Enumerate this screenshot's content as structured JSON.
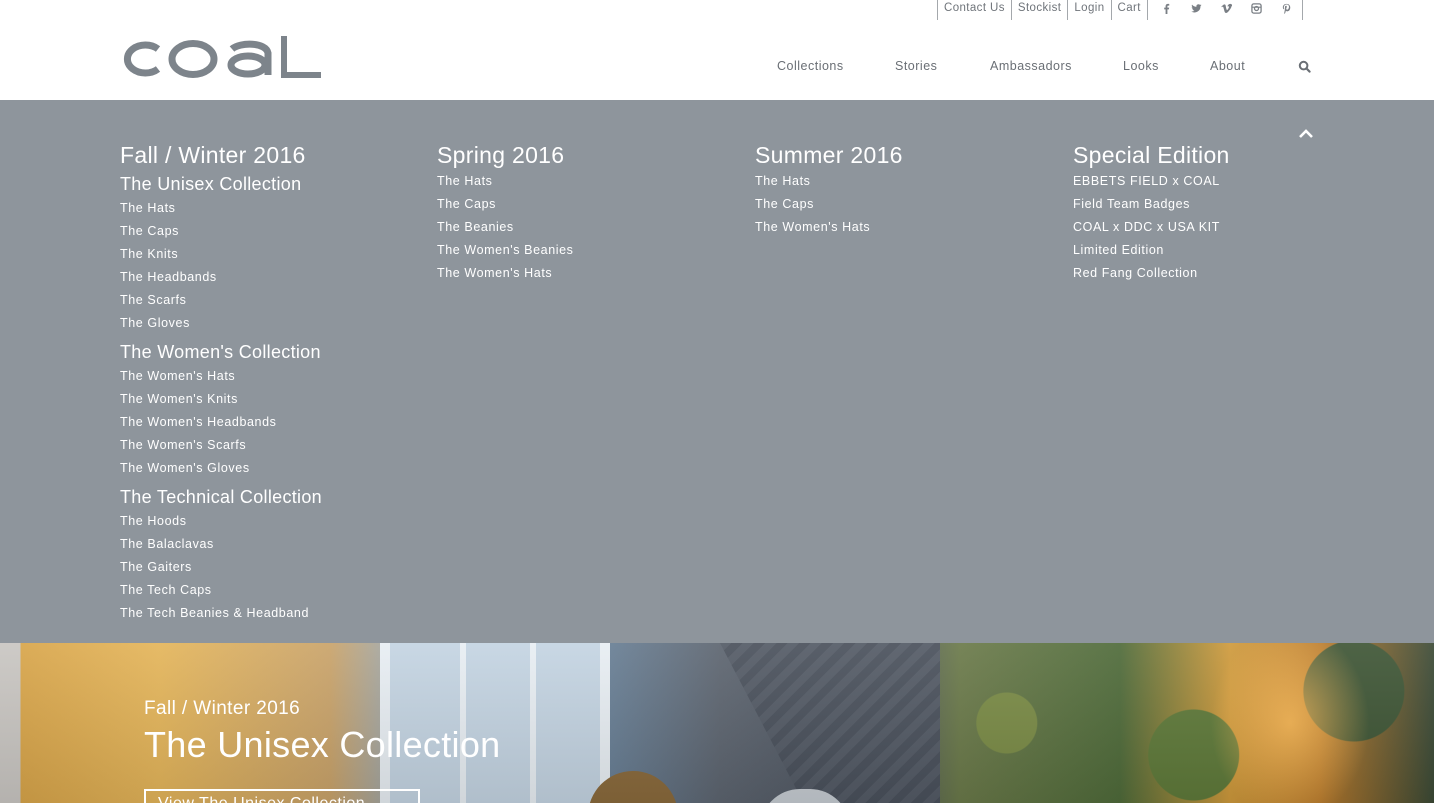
{
  "header": {
    "brand": "coal",
    "utility_links": [
      "Contact Us",
      "Stockist",
      "Login",
      "Cart"
    ],
    "social_icons": [
      "facebook-icon",
      "twitter-icon",
      "vimeo-icon",
      "instagram-icon",
      "pinterest-icon"
    ],
    "nav": [
      "Collections",
      "Stories",
      "Ambassadors",
      "Looks",
      "About"
    ],
    "search_icon": "search-icon"
  },
  "mega_menu": {
    "background_color": "#8e959c",
    "columns": [
      {
        "season": "Fall / Winter 2016",
        "groups": [
          {
            "title": "The Unisex Collection",
            "items": [
              "The Hats",
              "The Caps",
              "The Knits",
              "The Headbands",
              "The Scarfs",
              "The Gloves"
            ]
          },
          {
            "title": "The Women's Collection",
            "items": [
              "The Women's Hats",
              "The Women's Knits",
              "The Women's Headbands",
              "The Women's Scarfs",
              "The Women's Gloves"
            ]
          },
          {
            "title": "The Technical Collection",
            "items": [
              "The Hoods",
              "The Balaclavas",
              "The Gaiters",
              "The Tech Caps",
              "The Tech Beanies & Headband"
            ]
          }
        ]
      },
      {
        "season": "Spring 2016",
        "items": [
          "The Hats",
          "The Caps",
          "The Beanies",
          "The Women's Beanies",
          "The Women's Hats"
        ]
      },
      {
        "season": "Summer 2016",
        "items": [
          "The Hats",
          "The Caps",
          "The Women's Hats"
        ]
      },
      {
        "season": "Special Edition",
        "items": [
          "EBBETS FIELD x COAL",
          "Field Team Badges",
          "COAL x DDC x USA KIT",
          "Limited Edition",
          "Red Fang Collection"
        ]
      }
    ],
    "collapse_icon": "chevron-up-icon"
  },
  "hero": {
    "season": "Fall / Winter 2016",
    "title": "The Unisex Collection",
    "cta": "View The Unisex Collection"
  },
  "colors": {
    "text_gray": "#6a6f75",
    "logo_gray": "#7d848b",
    "menu_bg": "#8e959c",
    "white": "#ffffff"
  }
}
